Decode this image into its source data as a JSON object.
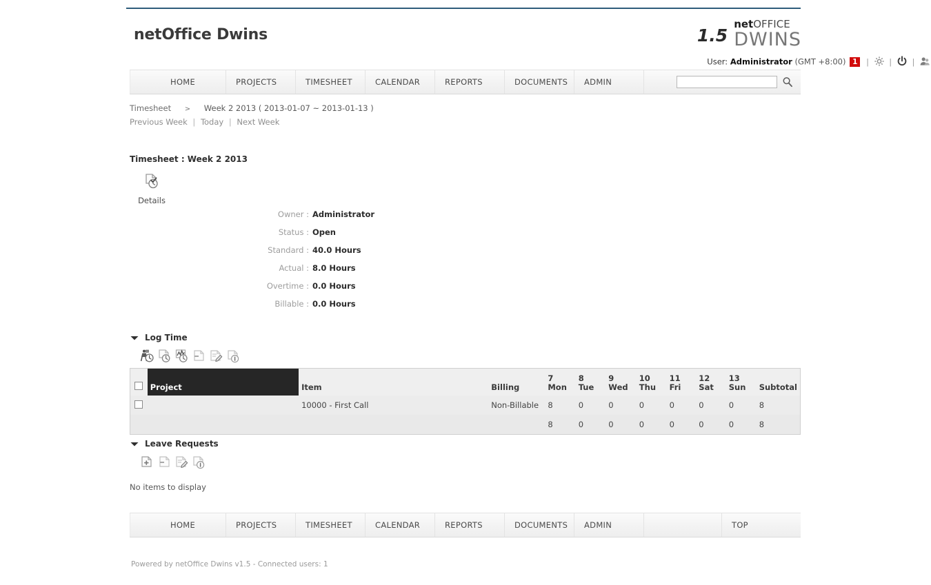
{
  "header": {
    "brand_title": "netOffice Dwins",
    "logo": {
      "version": "1.5",
      "word_net": "net",
      "word_office": "OFFICE",
      "word_dwins": "DWINS"
    },
    "userbar": {
      "user_prefix": "User:",
      "user_name": "Administrator",
      "timezone": "(GMT +8:00)",
      "alert_count": "1",
      "settings_icon": "gear-icon",
      "logout_icon": "power-icon",
      "profile_icon": "user-icon"
    }
  },
  "nav": {
    "items": [
      {
        "label": "HOME"
      },
      {
        "label": "PROJECTS"
      },
      {
        "label": "TIMESHEET"
      },
      {
        "label": "CALENDAR"
      },
      {
        "label": "REPORTS"
      },
      {
        "label": "DOCUMENTS"
      },
      {
        "label": "ADMIN"
      }
    ],
    "search": {
      "value": "",
      "placeholder": "",
      "icon": "search-icon"
    }
  },
  "breadcrumb": {
    "root": "Timesheet",
    "arrow": ">",
    "current": "Week 2 2013 ( 2013-01-07 ~ 2013-01-13 )"
  },
  "week_nav": {
    "previous": "Previous Week",
    "today": "Today",
    "next": "Next Week",
    "separator": "|"
  },
  "main": {
    "page_title": "Timesheet : Week 2 2013",
    "details_button": {
      "label": "Details",
      "icon": "document-clock-icon"
    },
    "detail_fields": [
      {
        "label": "Owner :",
        "value": "Administrator"
      },
      {
        "label": "Status :",
        "value": "Open"
      },
      {
        "label": "Standard :",
        "value": "40.0 Hours"
      },
      {
        "label": "Actual :",
        "value": "8.0 Hours"
      },
      {
        "label": "Overtime :",
        "value": "0.0 Hours"
      },
      {
        "label": "Billable :",
        "value": "0.0 Hours"
      }
    ]
  },
  "log_time": {
    "title": "Log Time",
    "caret_icon": "caret-down-icon",
    "toolbar": [
      {
        "icon": "person-clock-icon",
        "name": "log-time-resource"
      },
      {
        "icon": "page-clock-icon",
        "name": "log-time-add"
      },
      {
        "icon": "chart-clock-icon",
        "name": "log-time-chart"
      },
      {
        "icon": "page-minus-icon",
        "name": "log-time-delete"
      },
      {
        "icon": "page-edit-icon",
        "name": "log-time-edit"
      },
      {
        "icon": "page-info-icon",
        "name": "log-time-info"
      }
    ],
    "table": {
      "columns": [
        "Project",
        "Item",
        "Billing"
      ],
      "highlighted_column": "Project",
      "day_columns": [
        {
          "num": "7",
          "day": "Mon"
        },
        {
          "num": "8",
          "day": "Tue"
        },
        {
          "num": "9",
          "day": "Wed"
        },
        {
          "num": "10",
          "day": "Thu"
        },
        {
          "num": "11",
          "day": "Fri"
        },
        {
          "num": "12",
          "day": "Sat"
        },
        {
          "num": "13",
          "day": "Sun"
        }
      ],
      "subtotal_header": "Subtotal",
      "rows": [
        {
          "project": "",
          "item": "10000 - First Call",
          "billing": "Non-Billable",
          "days": [
            "8",
            "0",
            "0",
            "0",
            "0",
            "0",
            "0"
          ],
          "subtotal": "8"
        }
      ],
      "totals": {
        "days": [
          "8",
          "0",
          "0",
          "0",
          "0",
          "0",
          "0"
        ],
        "subtotal": "8"
      }
    }
  },
  "leave_requests": {
    "title": "Leave Requests",
    "caret_icon": "caret-down-icon",
    "toolbar": [
      {
        "icon": "page-plus-icon",
        "name": "leave-add"
      },
      {
        "icon": "page-minus-icon",
        "name": "leave-delete"
      },
      {
        "icon": "page-edit-icon",
        "name": "leave-edit"
      },
      {
        "icon": "page-info-icon",
        "name": "leave-info"
      }
    ],
    "empty_message": "No items to display"
  },
  "footer": {
    "items": [
      {
        "label": "HOME"
      },
      {
        "label": "PROJECTS"
      },
      {
        "label": "TIMESHEET"
      },
      {
        "label": "CALENDAR"
      },
      {
        "label": "REPORTS"
      },
      {
        "label": "DOCUMENTS"
      },
      {
        "label": "ADMIN"
      },
      {
        "label": ""
      },
      {
        "label": "TOP"
      }
    ],
    "powered_by": "Powered by netOffice Dwins v1.5 - Connected users: 1"
  },
  "colors": {
    "top_rule": "#2e5c7a",
    "alert_badge": "#d10b0b",
    "header_highlight": "#262626"
  }
}
